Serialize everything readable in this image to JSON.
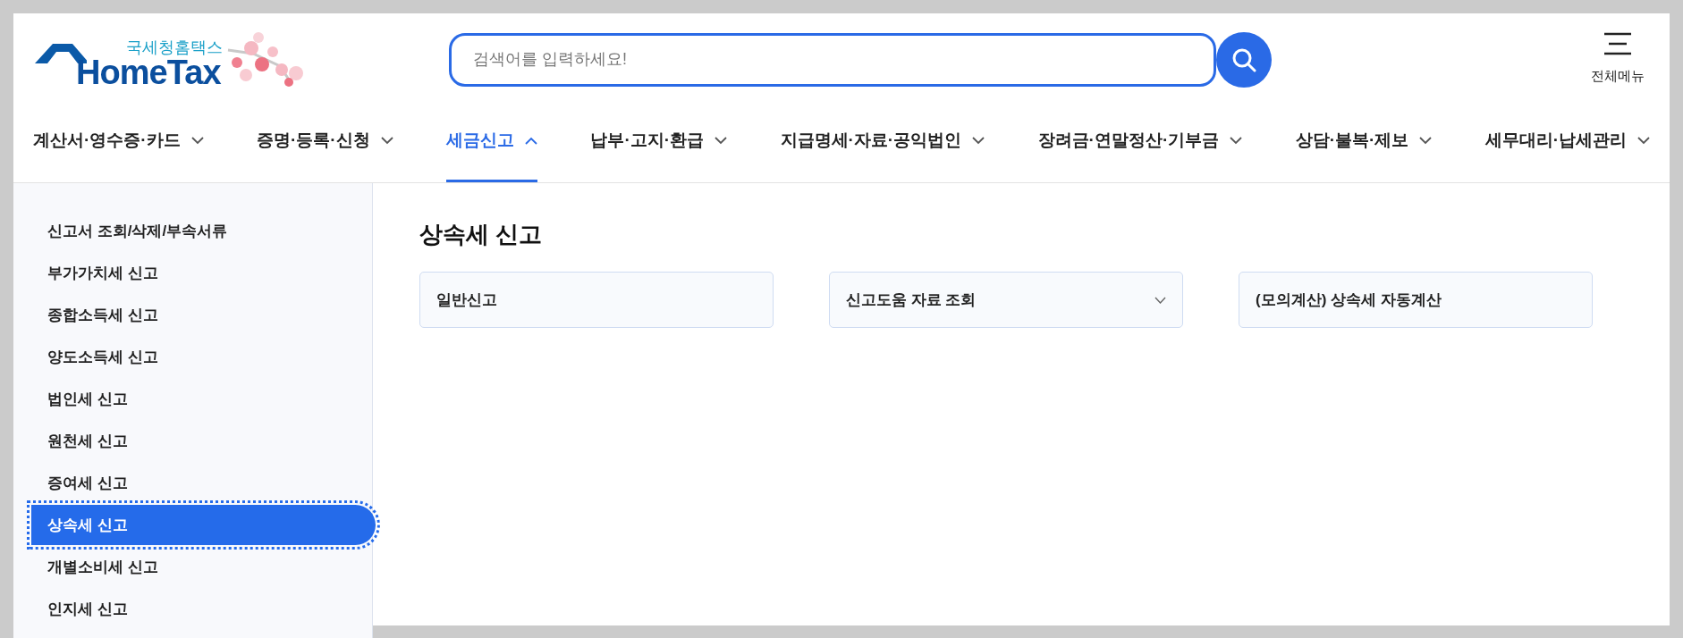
{
  "logo": {
    "subtitle": "국세청홈택스",
    "name": "HomeTax"
  },
  "search": {
    "placeholder": "검색어를 입력하세요!"
  },
  "all_menu": {
    "label": "전체메뉴"
  },
  "nav": [
    {
      "label": "계산서·영수증·카드",
      "selected": false
    },
    {
      "label": "증명·등록·신청",
      "selected": false
    },
    {
      "label": "세금신고",
      "selected": true
    },
    {
      "label": "납부·고지·환급",
      "selected": false
    },
    {
      "label": "지급명세·자료·공익법인",
      "selected": false
    },
    {
      "label": "장려금·연말정산·기부금",
      "selected": false
    },
    {
      "label": "상담·불복·제보",
      "selected": false
    },
    {
      "label": "세무대리·납세관리",
      "selected": false
    }
  ],
  "sidebar": {
    "items": [
      {
        "label": "신고서 조회/삭제/부속서류",
        "selected": false
      },
      {
        "label": "부가가치세 신고",
        "selected": false
      },
      {
        "label": "종합소득세 신고",
        "selected": false
      },
      {
        "label": "양도소득세 신고",
        "selected": false
      },
      {
        "label": "법인세 신고",
        "selected": false
      },
      {
        "label": "원천세 신고",
        "selected": false
      },
      {
        "label": "증여세 신고",
        "selected": false
      },
      {
        "label": "상속세 신고",
        "selected": true
      },
      {
        "label": "개별소비세 신고",
        "selected": false
      },
      {
        "label": "인지세 신고",
        "selected": false
      }
    ]
  },
  "content": {
    "title": "상속세 신고",
    "cards": [
      {
        "label": "일반신고",
        "kind": "link"
      },
      {
        "label": "신고도움 자료 조회",
        "kind": "dropdown"
      },
      {
        "label": "(모의계산) 상속세 자동계산",
        "kind": "link"
      }
    ]
  }
}
